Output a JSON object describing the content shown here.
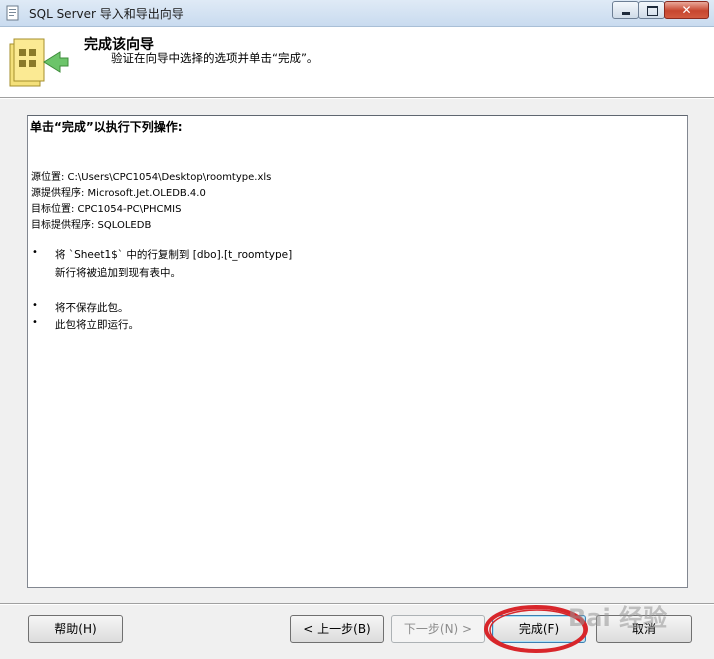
{
  "window": {
    "title": "SQL Server 导入和导出向导",
    "close_symbol": "✕"
  },
  "header": {
    "title": "完成该向导",
    "subtitle": "验证在向导中选择的选项并单击“完成”。"
  },
  "summary": {
    "heading": "单击“完成”以执行下列操作:",
    "info_lines": [
      "源位置: C:\\Users\\CPC1054\\Desktop\\roomtype.xls",
      "源提供程序: Microsoft.Jet.OLEDB.4.0",
      "目标位置: CPC1054-PC\\PHCMIS",
      "目标提供程序: SQLOLEDB"
    ],
    "bullet_symbol": "•",
    "bullets": [
      {
        "text": "将 `Sheet1$` 中的行复制到 [dbo].[t_roomtype]",
        "subtext": "新行将被追加到现有表中。"
      },
      {
        "text": "将不保存此包。"
      },
      {
        "text": "此包将立即运行。"
      }
    ]
  },
  "buttons": {
    "help": "帮助(H)",
    "back": "< 上一步(B)",
    "next": "下一步(N) >",
    "finish": "完成(F)",
    "cancel": "取消"
  },
  "watermark": "Bai 经验"
}
